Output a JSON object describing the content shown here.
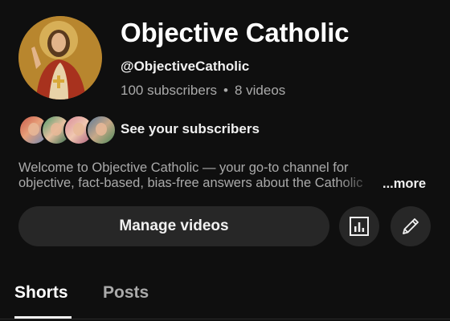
{
  "channel": {
    "title": "Objective Catholic",
    "handle": "@ObjectiveCatholic",
    "subscribers": "100 subscribers",
    "dot": "•",
    "videos": "8 videos"
  },
  "subscribers_row": {
    "label": "See your subscribers",
    "avatar_icons": [
      "subscriber-avatar",
      "subscriber-avatar",
      "subscriber-avatar",
      "subscriber-avatar"
    ]
  },
  "description": {
    "text": "Welcome to Objective Catholic — your go-to channel for objective, fact-based, bias-free answers about the Catholic faith.",
    "more_label": "...more"
  },
  "actions": {
    "manage_label": "Manage videos",
    "analytics_icon": "analytics-icon",
    "edit_icon": "pencil-icon"
  },
  "tabs": [
    {
      "label": "Shorts",
      "selected": true
    },
    {
      "label": "Posts",
      "selected": false
    }
  ],
  "colors": {
    "background": "#0f0f0f",
    "button_bg": "#272727",
    "text_primary": "#f1f1f1",
    "text_secondary": "#aaaaaa"
  }
}
